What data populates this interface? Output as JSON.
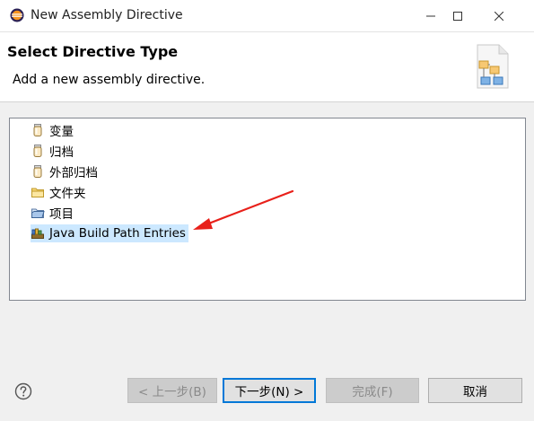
{
  "window": {
    "title": "New Assembly Directive",
    "icon": "eclipse-icon",
    "controls": [
      "minimize-icon",
      "maximize-icon",
      "close-icon"
    ]
  },
  "header": {
    "title": "Select Directive Type",
    "description": "Add a new assembly directive.",
    "image": "wizard-banner-icon"
  },
  "tree": {
    "items": [
      {
        "label": "变量",
        "icon": "jar-icon"
      },
      {
        "label": "归档",
        "icon": "jar-icon"
      },
      {
        "label": "外部归档",
        "icon": "jar-icon"
      },
      {
        "label": "文件夹",
        "icon": "folder-icon"
      },
      {
        "label": "项目",
        "icon": "project-icon"
      },
      {
        "label": "Java Build Path Entries",
        "icon": "library-icon",
        "selected": true
      }
    ]
  },
  "annotation": {
    "color": "#e8201a",
    "type": "arrow"
  },
  "buttons": {
    "back": "< 上一步(B)",
    "next": "下一步(N) >",
    "finish": "完成(F)",
    "cancel": "取消"
  }
}
